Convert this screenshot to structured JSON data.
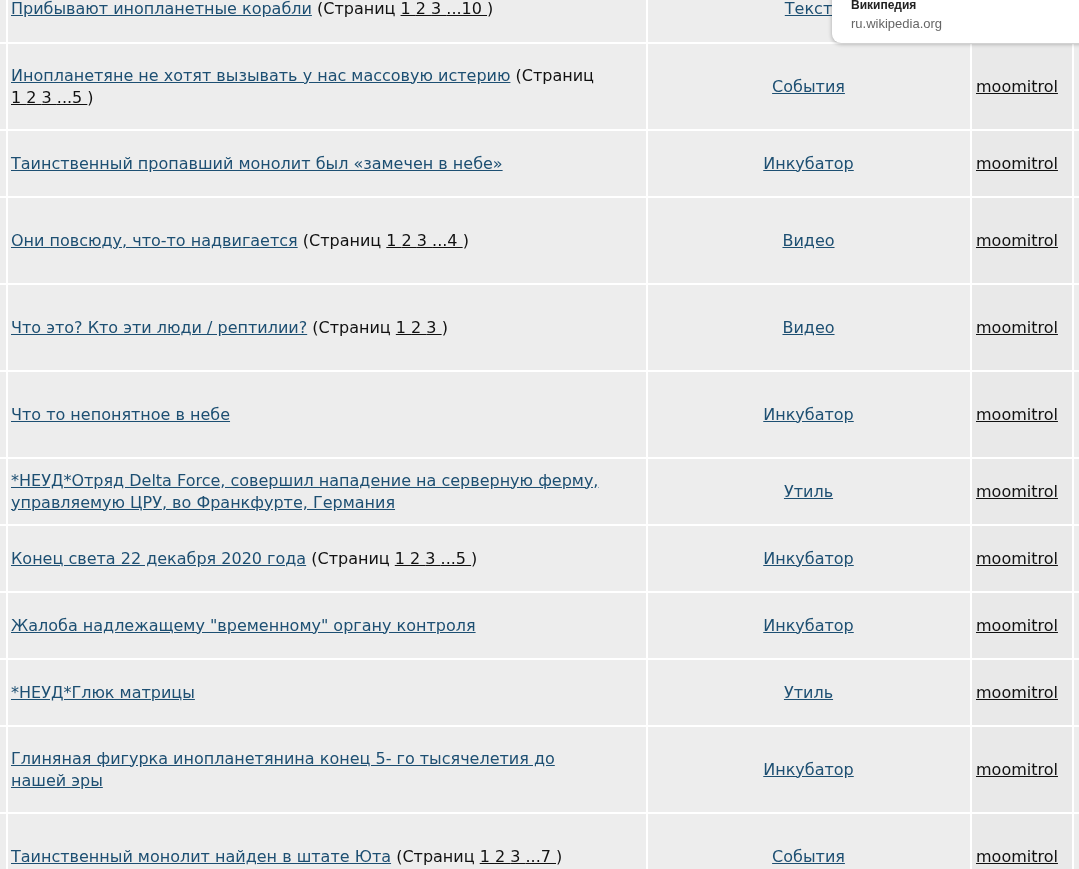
{
  "rows": [
    {
      "title": "Прибывают инопланетные корабли",
      "pages": {
        "label": "(Страниц",
        "links": [
          "1",
          "2",
          "3",
          "...10"
        ],
        "end": ")"
      },
      "category": "Текст"
    },
    {
      "title": "Инопланетяне не хотят вызывать у нас массовую истерию",
      "pages": {
        "label": "(Страниц",
        "links": [
          "1",
          "2",
          "3",
          "...5"
        ],
        "end": ")"
      },
      "category": "События",
      "author": "moomitrol"
    },
    {
      "title": "Таинственный пропавший монолит был «замечен в небе»",
      "category": "Инкубатор",
      "author": "moomitrol"
    },
    {
      "title": "Они повсюду, что-то надвигается",
      "pages": {
        "label": "(Страниц",
        "links": [
          "1",
          "2",
          "3",
          "...4"
        ],
        "end": ")"
      },
      "category": "Видео",
      "author": "moomitrol"
    },
    {
      "title": "Что это? Кто эти люди / рептилии?",
      "pages": {
        "label": "(Страниц",
        "links": [
          "1",
          "2",
          "3"
        ],
        "end": ")"
      },
      "category": "Видео",
      "author": "moomitrol"
    },
    {
      "title": "Что то непонятное в небе",
      "category": "Инкубатор",
      "author": "moomitrol"
    },
    {
      "title": "*НЕУД*Отряд Delta Force, совершил нападение на серверную ферму, управляемую ЦРУ, во Франкфурте, Германия",
      "category": "Утиль",
      "author": "moomitrol"
    },
    {
      "title": "Конец света 22 декабря 2020 года",
      "pages": {
        "label": "(Страниц",
        "links": [
          "1",
          "2",
          "3",
          "...5"
        ],
        "end": ")"
      },
      "category": "Инкубатор",
      "author": "moomitrol"
    },
    {
      "title": "Жалоба надлежащему \"временному\" органу контроля",
      "category": "Инкубатор",
      "author": "moomitrol"
    },
    {
      "title": "*НЕУД*Глюк матрицы",
      "category": "Утиль",
      "author": "moomitrol"
    },
    {
      "title": "Глиняная фигурка инопланетянина конец 5- го тысячелетия до нашей эры",
      "category": "Инкубатор",
      "author": "moomitrol"
    },
    {
      "title": "Таинственный монолит найден в штате Юта",
      "pages": {
        "label": "(Страниц",
        "links": [
          "1",
          "2",
          "3",
          "...7"
        ],
        "end": ")"
      },
      "category": "События",
      "author": "moomitrol"
    }
  ],
  "tooltip": {
    "title": "Википедия",
    "url": "ru.wikipedia.org"
  }
}
